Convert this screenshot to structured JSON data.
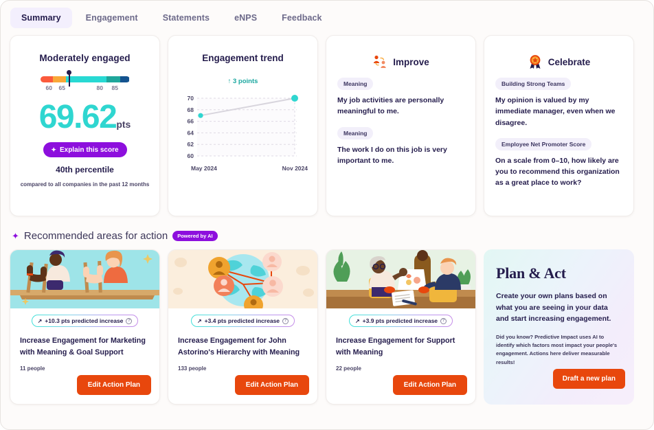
{
  "tabs": [
    {
      "label": "Summary",
      "active": true
    },
    {
      "label": "Engagement",
      "active": false
    },
    {
      "label": "Statements",
      "active": false
    },
    {
      "label": "eNPS",
      "active": false
    },
    {
      "label": "Feedback",
      "active": false
    }
  ],
  "score_card": {
    "title": "Moderately engaged",
    "gauge_ticks": [
      "60",
      "65",
      "80",
      "85"
    ],
    "value": "69.62",
    "unit": "pts",
    "explain_button": "Explain this score",
    "percentile": "40th percentile",
    "percentile_sub": "compared to all companies in the past 12 months",
    "accent_color": "#2fd6d0",
    "button_color": "#8d0fdd"
  },
  "trend_card": {
    "title": "Engagement trend",
    "delta": "3 points",
    "delta_arrow": "↑"
  },
  "chart_data": {
    "type": "line",
    "title": "Engagement trend",
    "x": [
      "May 2024",
      "Nov 2024"
    ],
    "values": [
      67,
      70
    ],
    "ylim": [
      60,
      70
    ],
    "yticks": [
      60,
      62,
      64,
      66,
      68,
      70
    ],
    "xlabel": "",
    "ylabel": "",
    "grid": true,
    "legend": "none",
    "point_color": "#2fd6d0",
    "line_color": "#d8d5dd",
    "annotation": "↑ 3 points"
  },
  "improve_card": {
    "icon": "people-exchange-icon",
    "title": "Improve",
    "items": [
      {
        "tag": "Meaning",
        "statement": "My job activities are personally meaningful to me."
      },
      {
        "tag": "Meaning",
        "statement": "The work I do on this job is very important to me."
      }
    ]
  },
  "celebrate_card": {
    "icon": "award-rosette-icon",
    "title": "Celebrate",
    "items": [
      {
        "tag": "Building Strong Teams",
        "statement": "My opinion is valued by my immediate manager, even when we disagree."
      },
      {
        "tag": "Employee Net Promoter Score",
        "statement": "On a scale from 0–10, how likely are you to recommend this organization as a great place to work?"
      }
    ]
  },
  "recommended": {
    "heading": "Recommended areas for action",
    "badge": "Powered by AI",
    "cards": [
      {
        "image": "two-people-rowing-illustration",
        "pill": "+10.3 pts predicted increase",
        "title": "Increase Engagement for Marketing with Meaning & Goal Support",
        "people": "11 people",
        "button": "Edit Action Plan"
      },
      {
        "image": "globe-network-avatars-illustration",
        "pill": "+3.4 pts predicted increase",
        "title": "Increase Engagement for John Astorino's Hierarchy with Meaning",
        "people": "133 people",
        "button": "Edit Action Plan"
      },
      {
        "image": "team-meeting-illustration",
        "pill": "+3.9 pts predicted increase",
        "title": "Increase Engagement for Support with Meaning",
        "people": "22 people",
        "button": "Edit Action Plan"
      }
    ]
  },
  "plan_act": {
    "title": "Plan & Act",
    "body": "Create your own plans based on what you are seeing in your data and start increasing engagement.",
    "note": "Did you know? Predictive Impact uses AI to identify which factors most impact your people's engagement. Actions here deliver measurable results!",
    "button": "Draft a new plan"
  }
}
